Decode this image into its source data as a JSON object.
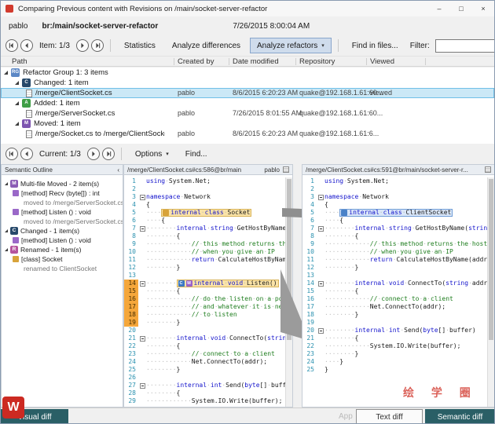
{
  "window": {
    "title": "Comparing Previous content with Revisions on /main/socket-server-refactor",
    "controls": {
      "minimize": "–",
      "maximize": "□",
      "close": "×"
    }
  },
  "context": {
    "user": "pablo",
    "branch": "br:/main/socket-server-refactor",
    "timestamp": "7/26/2015 8:00:04 AM"
  },
  "toolbar": {
    "item_counter": "Item: 1/3",
    "statistics": "Statistics",
    "analyze_differences": "Analyze differences",
    "analyze_refactors": "Analyze refactors",
    "find_in_files": "Find in files...",
    "filter_label": "Filter:",
    "filter_value": ""
  },
  "columns": [
    "Path",
    "Created by",
    "Date modified",
    "Repository",
    "Viewed"
  ],
  "tree": [
    {
      "type": "group",
      "lvl": 0,
      "icon": "RG",
      "iconColor": "#5b87c5",
      "label": "Refactor Group 1: 3 items"
    },
    {
      "type": "cat",
      "lvl": 1,
      "icon": "C",
      "iconColor": "#27496b",
      "label": "Changed: 1 item"
    },
    {
      "type": "file",
      "lvl": 2,
      "label": "/merge/ClientSocket.cs",
      "created_by": "pablo",
      "date": "8/6/2015 6:20:23 AM",
      "repo": "quake@192.168.1.61:60...",
      "viewed": "viewed",
      "selected": true
    },
    {
      "type": "cat",
      "lvl": 1,
      "icon": "A",
      "iconColor": "#3f9e46",
      "label": "Added: 1 item"
    },
    {
      "type": "file",
      "lvl": 2,
      "label": "/merge/ServerSocket.cs",
      "created_by": "pablo",
      "date": "7/26/2015 8:01:55 AM",
      "repo": "quake@192.168.1.61:60...",
      "viewed": ""
    },
    {
      "type": "cat",
      "lvl": 1,
      "icon": "M",
      "iconColor": "#7d55b0",
      "label": "Moved: 1 item"
    },
    {
      "type": "file",
      "lvl": 2,
      "label": "/merge/Socket.cs to /merge/ClientSocket.cs",
      "created_by": "pablo",
      "date": "8/6/2015 6:20:23 AM",
      "repo": "quake@192.168.1.61:6...",
      "viewed": ""
    }
  ],
  "toolbar2": {
    "current_counter": "Current: 1/3",
    "options": "Options",
    "find": "Find..."
  },
  "outline": {
    "title": "Semantic Outline",
    "collapse": "‹",
    "items": [
      {
        "lvl": 0,
        "icon": "M",
        "iconColor": "#8a5bb5",
        "label": "Multi-file Moved - 2 item(s)",
        "expander": true
      },
      {
        "lvl": 1,
        "icon": "method",
        "label": "[method] Recv (byte[]) : int"
      },
      {
        "lvl": 2,
        "sub": true,
        "label": "moved to /merge/ServerSocket.cs"
      },
      {
        "lvl": 1,
        "icon": "method",
        "label": "[method] Listen () : void"
      },
      {
        "lvl": 2,
        "sub": true,
        "label": "moved to /merge/ServerSocket.cs"
      },
      {
        "lvl": 0,
        "icon": "C",
        "iconColor": "#27496b",
        "label": "Changed - 1 item(s)",
        "expander": true
      },
      {
        "lvl": 1,
        "icon": "method",
        "label": "[method] Listen () : void"
      },
      {
        "lvl": 0,
        "icon": "R",
        "iconColor": "#b5549e",
        "label": "Renamed - 1 item(s)",
        "expander": true
      },
      {
        "lvl": 1,
        "icon": "class",
        "label": "[class] Socket"
      },
      {
        "lvl": 2,
        "sub": true,
        "label": "renamed to ClientSocket"
      }
    ]
  },
  "left_editor": {
    "header": "/merge/ClientSocket.cs#cs:586@br/main",
    "header_user": "pablo",
    "lines": [
      {
        "t": "using System.Net;"
      },
      {
        "t": ""
      },
      {
        "t": "namespace Network",
        "fold": true
      },
      {
        "t": "{"
      },
      {
        "t": "    internal class Socket",
        "hl": "yellow",
        "badges": [
          {
            "t": "",
            "c": "#d8a33a"
          }
        ]
      },
      {
        "t": "    {"
      },
      {
        "t": "        internal string GetHostByName(string addr)",
        "fold": true
      },
      {
        "t": "        {"
      },
      {
        "t": "            // this method returns the host name"
      },
      {
        "t": "            // when you give an IP"
      },
      {
        "t": "            return CalculateHostByName(addr);"
      },
      {
        "t": "        }"
      },
      {
        "t": ""
      },
      {
        "t": "        internal void Listen()",
        "fold": true,
        "hl": "yellow",
        "gutter": true,
        "badges": [
          {
            "t": "C",
            "c": "#3b78c4"
          },
          {
            "t": "M",
            "c": "#9a62c9"
          }
        ]
      },
      {
        "t": "        {",
        "gutter": true
      },
      {
        "t": "            // do the listen on a port",
        "gutter": true
      },
      {
        "t": "            // and whatever it is needed",
        "gutter": true
      },
      {
        "t": "            // to listen",
        "gutter": true
      },
      {
        "t": "        }",
        "gutter": true
      },
      {
        "t": ""
      },
      {
        "t": "        internal void ConnectTo(string addr)",
        "fold": true
      },
      {
        "t": "        {"
      },
      {
        "t": "            // connect to a client"
      },
      {
        "t": "            Net.ConnectTo(addr);"
      },
      {
        "t": "        }"
      },
      {
        "t": ""
      },
      {
        "t": "        internal int Send(byte[] buffer)",
        "fold": true
      },
      {
        "t": "        {"
      },
      {
        "t": "            System.IO.Write(buffer);"
      }
    ]
  },
  "right_editor": {
    "header": "/merge/ClientSocket.cs#cs:591@br/main/socket-server-r...",
    "lines": [
      {
        "t": "using System.Net;"
      },
      {
        "t": ""
      },
      {
        "t": "namespace Network",
        "fold": true
      },
      {
        "t": "{"
      },
      {
        "t": "    internal class ClientSocket",
        "hl": "blue",
        "badges": [
          {
            "t": "",
            "c": "#4a82c8"
          }
        ]
      },
      {
        "t": "    {"
      },
      {
        "t": "        internal string GetHostByName(string addr)",
        "fold": true
      },
      {
        "t": "        {"
      },
      {
        "t": "            // this method returns the host name"
      },
      {
        "t": "            // when you give an IP"
      },
      {
        "t": "            return CalculateHostByName(addr);"
      },
      {
        "t": "        }"
      },
      {
        "t": ""
      },
      {
        "t": "        internal void ConnectTo(string addr)",
        "fold": true
      },
      {
        "t": "        {"
      },
      {
        "t": "            // connect to a client"
      },
      {
        "t": "            Net.ConnectTo(addr);"
      },
      {
        "t": "        }"
      },
      {
        "t": ""
      },
      {
        "t": "        internal int Send(byte[] buffer)",
        "fold": true
      },
      {
        "t": "        {"
      },
      {
        "t": "            System.IO.Write(buffer);"
      },
      {
        "t": "        }"
      },
      {
        "t": "    }"
      },
      {
        "t": "}"
      }
    ]
  },
  "footer": {
    "visual_diff": "Visual diff",
    "text_diff": "Text diff",
    "semantic_diff": "Semantic diff"
  },
  "watermark": {
    "logo": "W",
    "red_text": "绘 学 圈",
    "gray_text": "App"
  }
}
